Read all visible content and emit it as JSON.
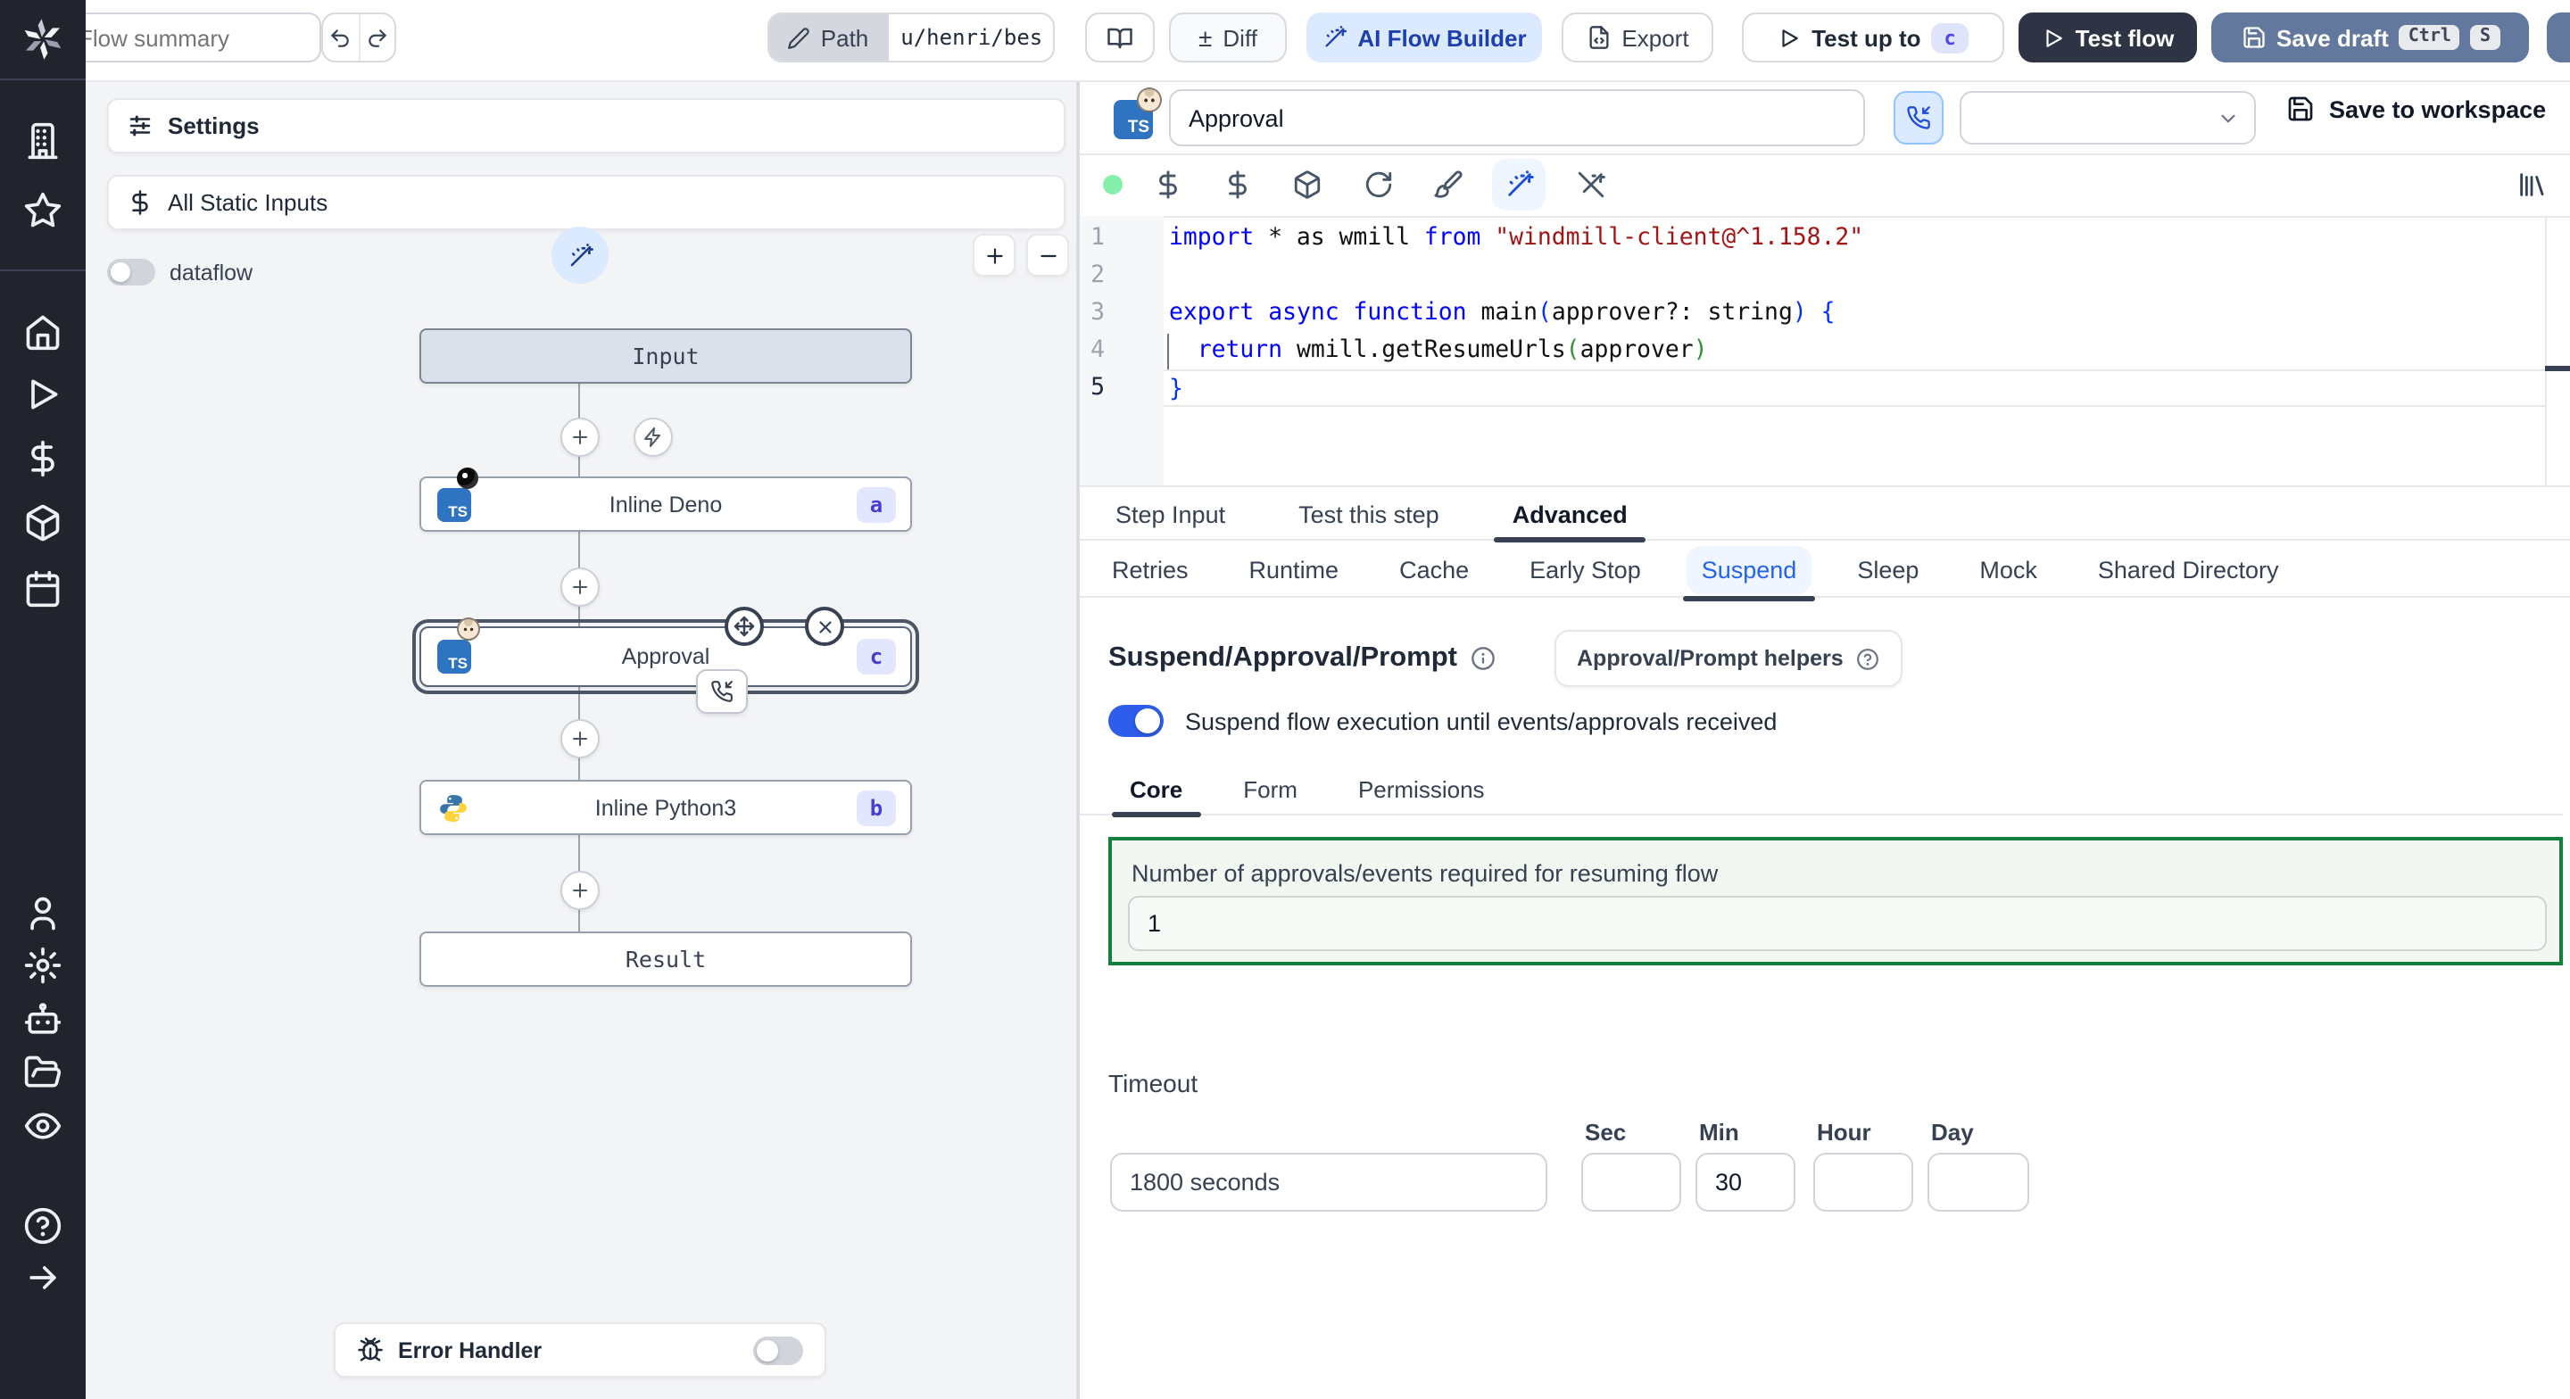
{
  "colors": {
    "accent_blue": "#2d5dea",
    "badge_bg": "#e3e7fe",
    "badge_text": "#4a3ecf",
    "green_border": "#15803d",
    "save_draft_bg": "#62789d",
    "dark_button_bg": "#2e3444",
    "sidebar_bg": "#21242d",
    "ai_builder_bg": "#dbeafe"
  },
  "topbar": {
    "flow_summary_placeholder": "Flow summary",
    "path_label": "Path",
    "path_value": "u/henri/bes",
    "diff_label": "Diff",
    "plus_minus": "±",
    "ai_builder_label": "AI Flow Builder",
    "export_label": "Export",
    "test_up_to_label": "Test up to",
    "test_up_to_badge": "c",
    "test_flow_label": "Test flow",
    "save_draft_label": "Save draft",
    "kbd_ctrl": "Ctrl",
    "kbd_s": "S"
  },
  "sidebar": {
    "icons": [
      "windmill-logo",
      "building",
      "star",
      "home",
      "runs-play",
      "variables-dollar",
      "resources-package",
      "schedules-calendar",
      "user",
      "settings-gear",
      "workers-robot",
      "folders",
      "audit-eye",
      "help",
      "expand-arrow"
    ]
  },
  "flow_panel": {
    "settings_label": "Settings",
    "static_inputs_label": "All Static Inputs",
    "dataflow_label": "dataflow",
    "error_handler_label": "Error Handler",
    "zoom_in": "+",
    "zoom_out": "−"
  },
  "graph": {
    "input_label": "Input",
    "result_label": "Result",
    "nodes": [
      {
        "label": "Inline Deno",
        "badge": "a",
        "lang": "deno"
      },
      {
        "label": "Approval",
        "badge": "c",
        "lang": "bun"
      },
      {
        "label": "Inline Python3",
        "badge": "b",
        "lang": "python"
      }
    ]
  },
  "right": {
    "header": {
      "name_value": "Approval",
      "save_to_workspace": "Save to workspace"
    },
    "toolbar_icons": [
      "status-dot",
      "variables-dollar",
      "variables-dollar-2",
      "package",
      "refresh",
      "paintbrush",
      "ai-wand",
      "wand-off",
      "library"
    ],
    "editor": {
      "lines": [
        {
          "num": "1",
          "cur": false,
          "tokens": [
            {
              "c": "kw",
              "t": "import"
            },
            {
              "c": "pl",
              "t": " * as wmill "
            },
            {
              "c": "kw",
              "t": "from"
            },
            {
              "c": "pl",
              "t": " "
            },
            {
              "c": "str",
              "t": "\"windmill-client@^1.158.2\""
            }
          ]
        },
        {
          "num": "2",
          "cur": false,
          "tokens": []
        },
        {
          "num": "3",
          "cur": false,
          "tokens": [
            {
              "c": "kw",
              "t": "export"
            },
            {
              "c": "pl",
              "t": " "
            },
            {
              "c": "kw",
              "t": "async"
            },
            {
              "c": "pl",
              "t": " "
            },
            {
              "c": "kw",
              "t": "function"
            },
            {
              "c": "pl",
              "t": " main"
            },
            {
              "c": "p1",
              "t": "("
            },
            {
              "c": "pl",
              "t": "approver?: string"
            },
            {
              "c": "p1",
              "t": ")"
            },
            {
              "c": "pl",
              "t": " "
            },
            {
              "c": "p1",
              "t": "{"
            }
          ]
        },
        {
          "num": "4",
          "cur": false,
          "tokens": [
            {
              "c": "pl",
              "t": "  "
            },
            {
              "c": "kw",
              "t": "return"
            },
            {
              "c": "pl",
              "t": " wmill.getResumeUrls"
            },
            {
              "c": "p2",
              "t": "("
            },
            {
              "c": "pl",
              "t": "approver"
            },
            {
              "c": "p2",
              "t": ")"
            }
          ]
        },
        {
          "num": "5",
          "cur": true,
          "tokens": [
            {
              "c": "p1",
              "t": "}"
            }
          ]
        }
      ]
    },
    "tabs": [
      "Step Input",
      "Test this step",
      "Advanced"
    ],
    "active_tab": "Advanced",
    "subtabs": [
      "Retries",
      "Runtime",
      "Cache",
      "Early Stop",
      "Suspend",
      "Sleep",
      "Mock",
      "Shared Directory"
    ],
    "active_subtab": "Suspend",
    "suspend": {
      "heading": "Suspend/Approval/Prompt",
      "helpers_button": "Approval/Prompt helpers",
      "toggle_label": "Suspend flow execution until events/approvals received",
      "core_tabs": [
        "Core",
        "Form",
        "Permissions"
      ],
      "active_core_tab": "Core",
      "approvals_label": "Number of approvals/events required for resuming flow",
      "approvals_value": "1",
      "timeout_label": "Timeout",
      "timeout_value": "1800 seconds",
      "unit_labels": [
        "Sec",
        "Min",
        "Hour",
        "Day"
      ],
      "sec_value": "",
      "min_value": "30",
      "hour_value": "",
      "day_value": ""
    }
  }
}
